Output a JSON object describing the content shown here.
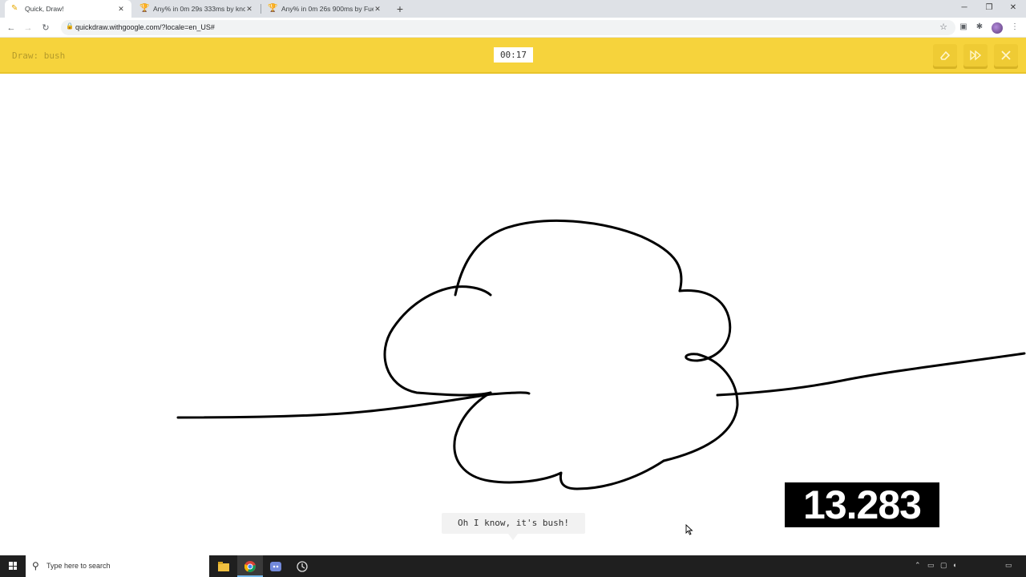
{
  "browser": {
    "tabs": [
      {
        "title": "Quick, Draw!",
        "icon": "quickdraw-favicon",
        "active": true
      },
      {
        "title": "Any% in 0m 29s 333ms by knogu",
        "icon": "trophy-icon",
        "active": false
      },
      {
        "title": "Any% in 0m 26s 900ms by Fuego",
        "icon": "trophy-icon",
        "active": false
      }
    ],
    "new_tab": "+",
    "url": "quickdraw.withgoogle.com/?locale=en_US#"
  },
  "game": {
    "prompt": "Draw: bush",
    "timer": "00:17",
    "guess_message": "Oh I know, it's bush!"
  },
  "overlay": {
    "split_time": "13.283"
  },
  "taskbar": {
    "search_placeholder": "Type here to search",
    "apps": [
      "file-explorer-icon",
      "chrome-icon",
      "discord-icon",
      "livesplit-icon"
    ]
  },
  "colors": {
    "header_yellow": "#f6d33c",
    "prompt_text": "#b49a2a",
    "taskbar": "#1f1f1f"
  }
}
